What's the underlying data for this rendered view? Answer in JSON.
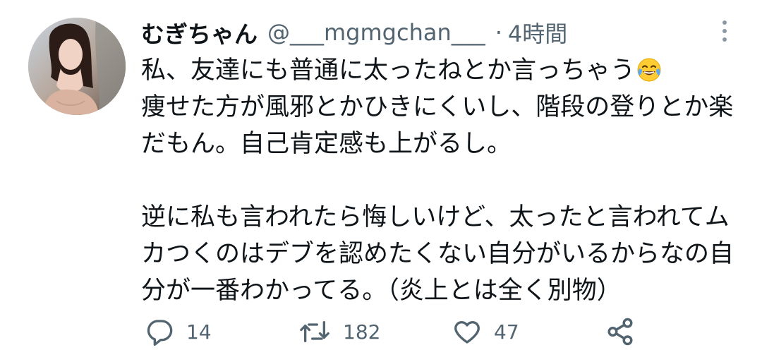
{
  "tweet": {
    "display_name": "むぎちゃん",
    "handle": "@___mgmgchan___",
    "separator": "·",
    "time": "4時間",
    "text_lines": [
      "私、友達にも普通に太ったねとか言っちゃう",
      "痩せた方が風邪とかひきにくいし、階段の登りとか楽",
      "だもん。自己肯定感も上がるし。",
      "",
      "逆に私も言われたら悔しいけど、太ったと言われてム",
      "カつくのはデブを認めたくない自分がいるからなの自",
      "分が一番わかってる。（炎上とは全く別物）"
    ],
    "emoji": "face-with-tears-of-joy",
    "actions": {
      "reply_count": "14",
      "retweet_count": "182",
      "like_count": "47"
    }
  },
  "icons": {
    "more": "more-vertical-icon",
    "reply": "reply-icon",
    "retweet": "retweet-icon",
    "like": "heart-icon",
    "share": "share-icon"
  },
  "colors": {
    "text_primary": "#0f1419",
    "text_secondary": "#536471",
    "icon_gray": "#536471"
  }
}
